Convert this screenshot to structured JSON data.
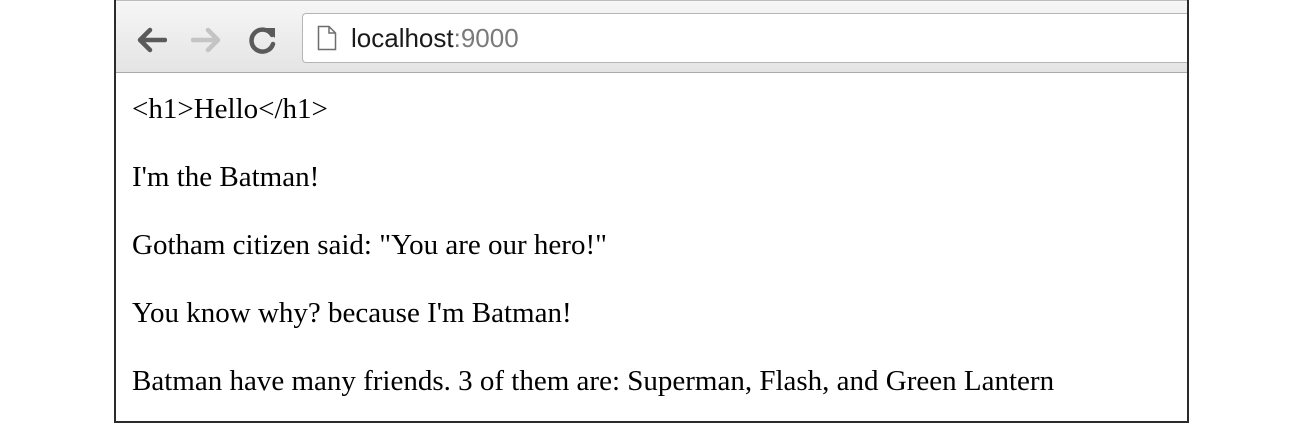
{
  "browser": {
    "address_bar": {
      "host": "localhost",
      "port": ":9000"
    },
    "icons": {
      "back": "back-arrow-icon",
      "forward": "forward-arrow-icon",
      "reload": "reload-icon",
      "page": "page-document-icon"
    }
  },
  "page": {
    "lines": [
      "<h1>Hello</h1>",
      "I'm the Batman!",
      "Gotham citizen said: \"You are our hero!\"",
      "You know why? because I'm Batman!",
      "Batman have many friends. 3 of them are: Superman, Flash, and Green Lantern"
    ]
  },
  "colors": {
    "toolbar_top": "#f6f6f6",
    "toolbar_bottom": "#e4e4e4",
    "port_text": "#7a7a7a",
    "disabled_icon": "#c4c4c4",
    "active_icon": "#5a5a5a"
  }
}
